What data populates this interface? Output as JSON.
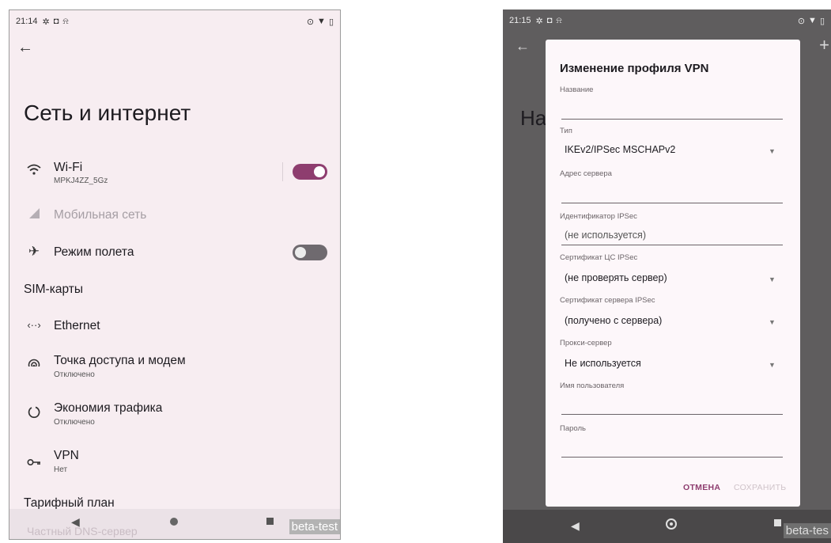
{
  "left": {
    "status": {
      "time": "21:14"
    },
    "page_title": "Сеть и интернет",
    "items": [
      {
        "title": "Wi-Fi",
        "subtitle": "MPKJ4ZZ_5Gz"
      },
      {
        "title": "Мобильная сеть"
      },
      {
        "title": "Режим полета"
      },
      {
        "title": "SIM-карты"
      },
      {
        "title": "Ethernet"
      },
      {
        "title": "Точка доступа и модем",
        "subtitle": "Отключено"
      },
      {
        "title": "Экономия трафика",
        "subtitle": "Отключено"
      },
      {
        "title": "VPN",
        "subtitle": "Нет"
      },
      {
        "title": "Тарифный план"
      }
    ],
    "ghost_item": "Частный DNS-сервер",
    "beta_label": "beta-test"
  },
  "right": {
    "status": {
      "time": "21:15"
    },
    "bg_title": "На",
    "dialog": {
      "title": "Изменение профиля VPN",
      "fields": {
        "name": {
          "label": "Название",
          "value": ""
        },
        "type": {
          "label": "Тип",
          "value": "IKEv2/IPSec MSCHAPv2"
        },
        "server": {
          "label": "Адрес сервера",
          "value": ""
        },
        "ipsec_id": {
          "label": "Идентификатор IPSec",
          "placeholder": "(не используется)"
        },
        "ca_cert": {
          "label": "Сертификат ЦС IPSec",
          "value": "(не проверять сервер)"
        },
        "server_cert": {
          "label": "Сертификат сервера IPSec",
          "value": "(получено с сервера)"
        },
        "proxy": {
          "label": "Прокси-сервер",
          "value": "Не используется"
        },
        "username": {
          "label": "Имя пользователя",
          "value": ""
        },
        "password": {
          "label": "Пароль",
          "value": ""
        }
      },
      "cancel_label": "ОТМЕНА",
      "save_label": "СОХРАНИТЬ"
    },
    "beta_label": "beta-tes"
  },
  "toggles": {
    "wifi_on": true,
    "airplane_on": false
  },
  "colors": {
    "accent": "#8e3d6f",
    "page_bg": "#f7edf1",
    "scrim": "#5f5d5e"
  }
}
